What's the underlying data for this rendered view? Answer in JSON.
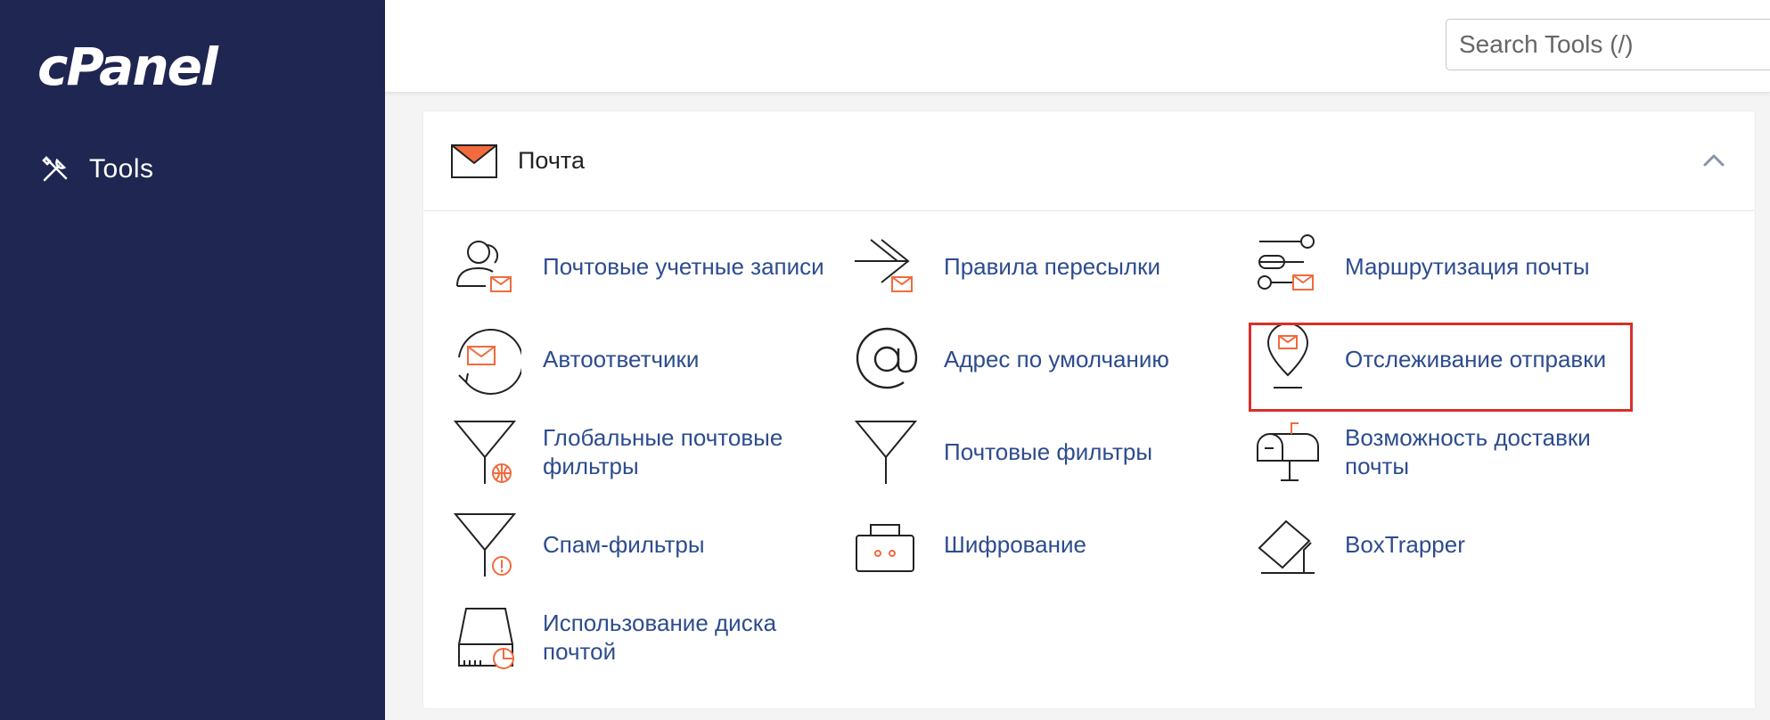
{
  "sidebar": {
    "logo": "cPanel",
    "items": [
      {
        "label": "Tools",
        "icon": "tools-icon"
      }
    ]
  },
  "header": {
    "search_placeholder": "Search Tools (/)"
  },
  "section": {
    "title": "Почта",
    "icon": "mail-envelope-icon"
  },
  "tools": [
    {
      "label": "Почтовые учетные записи",
      "icon": "email-accounts-icon"
    },
    {
      "label": "Правила пересылки",
      "icon": "forwarders-icon"
    },
    {
      "label": "Маршрутизация почты",
      "icon": "email-routing-icon"
    },
    {
      "label": "Автоответчики",
      "icon": "autoresponders-icon"
    },
    {
      "label": "Адрес по умолчанию",
      "icon": "default-address-icon"
    },
    {
      "label": "Отслеживание отправки",
      "icon": "track-delivery-icon",
      "highlighted": true
    },
    {
      "label": "Глобальные почтовые фильтры",
      "icon": "global-filters-icon"
    },
    {
      "label": "Почтовые фильтры",
      "icon": "email-filters-icon"
    },
    {
      "label": "Возможность доставки почты",
      "icon": "deliverability-icon"
    },
    {
      "label": "Спам-фильтры",
      "icon": "spam-filters-icon"
    },
    {
      "label": "Шифрование",
      "icon": "encryption-icon"
    },
    {
      "label": "BoxTrapper",
      "icon": "boxtrapper-icon"
    },
    {
      "label": "Использование диска почтой",
      "icon": "disk-usage-icon"
    }
  ],
  "colors": {
    "sidebar_bg": "#1f2651",
    "link": "#2d4c8e",
    "accent": "#f26a3d",
    "highlight": "#d7302a"
  }
}
